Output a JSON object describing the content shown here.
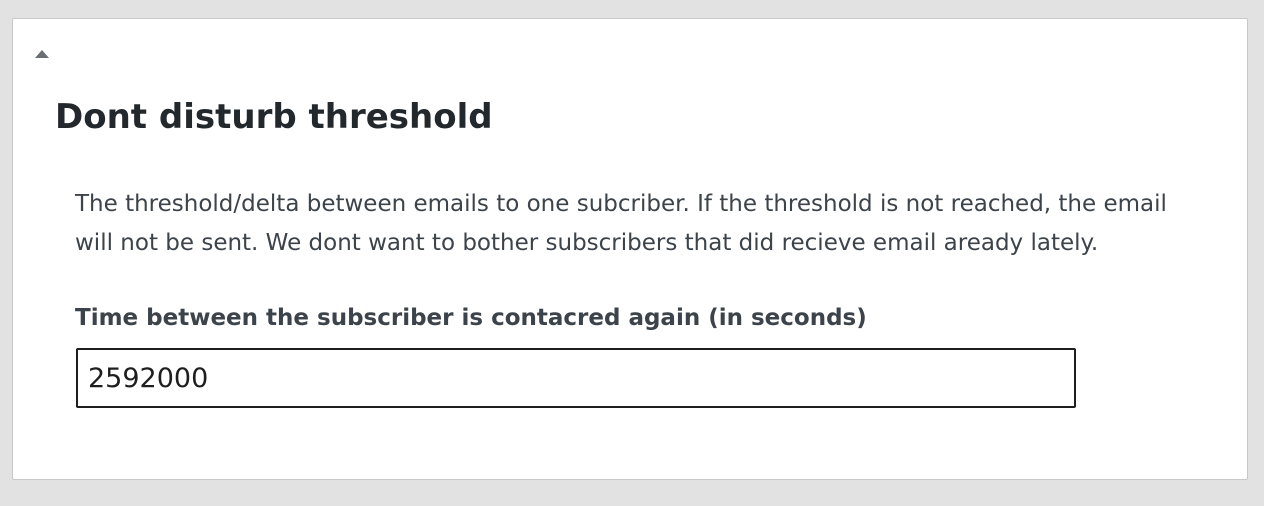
{
  "panel": {
    "toggle_icon": "triangle-up-icon",
    "title": "Dont disturb threshold",
    "description": "The threshold/delta between emails to one subcriber. If the threshold is not reached, the email will not be sent. We dont want to bother subscribers that did recieve email aready lately.",
    "field": {
      "label": "Time between the subscriber is contacred again (in seconds)",
      "value": "2592000"
    }
  },
  "colors": {
    "background": "#e2e2e2",
    "panel": "#ffffff",
    "heading_text": "#23282d",
    "body_text": "#3c434a",
    "input_border": "#1e1e1e"
  }
}
